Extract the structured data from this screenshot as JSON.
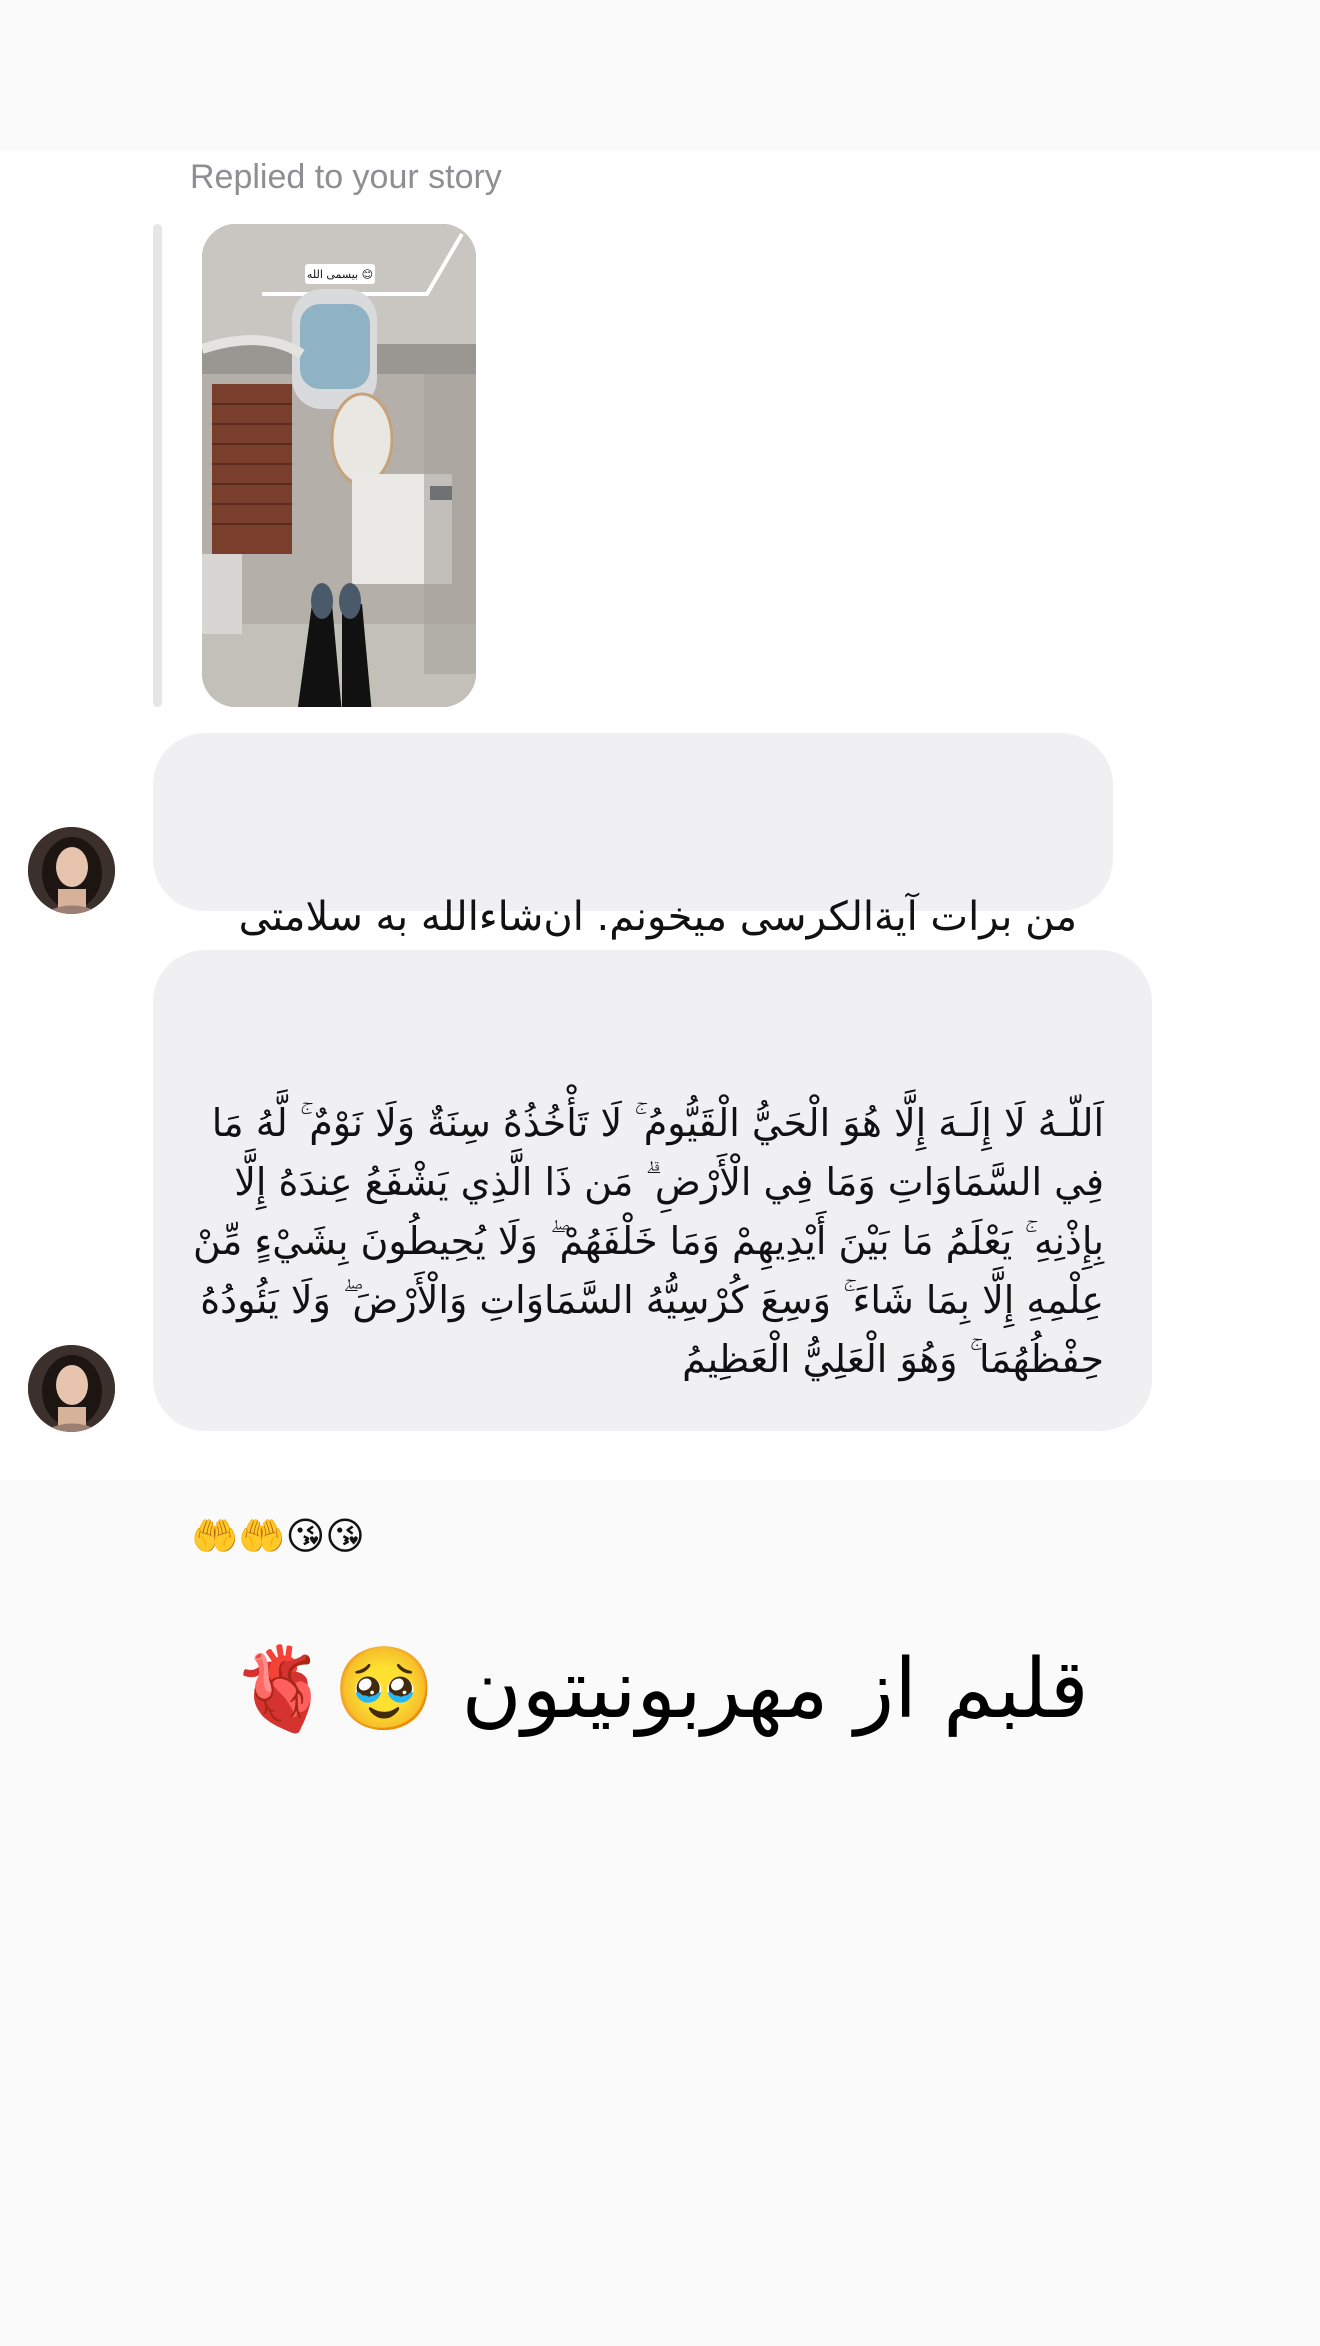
{
  "reply": {
    "label": "Replied to your story",
    "story_sticker_text": "بیسمی الله 😊"
  },
  "messages": [
    {
      "sender": "other",
      "text": "من برات آیةالکرسی میخونم. ان‌شاءالله به سلامتی تموم میشه",
      "emojis": "❤️🤲"
    },
    {
      "sender": "other",
      "text": "اَللّـهُ لَا إِلَـهَ إِلَّا هُوَ الْحَيُّ الْقَيُّومُ ۚ لَا تَأْخُذُهُ سِنَةٌ وَلَا نَوْمٌ ۚ لَّهُ مَا فِي السَّمَاوَاتِ وَمَا فِي الْأَرْضِ ۗ مَن ذَا الَّذِي يَشْفَعُ عِندَهُ إِلَّا بِإِذْنِهِ ۚ يَعْلَمُ مَا بَيْنَ أَيْدِيهِمْ وَمَا خَلْفَهُمْ ۖ وَلَا يُحِيطُونَ بِشَيْءٍ مِّنْ عِلْمِهِ إِلَّا بِمَا شَاءَ ۚ وَسِعَ كُرْسِيُّهُ السَّمَاوَاتِ وَالْأَرْضَ ۖ وَلَا يَئُودُهُ حِفْظُهُمَا ۚ وَهُوَ الْعَلِيُّ الْعَظِيمُ",
      "emojis": "🤲🤲😘😘"
    }
  ],
  "story_reaction_text": "قلبم از مهربونیتون 🥹🫀"
}
